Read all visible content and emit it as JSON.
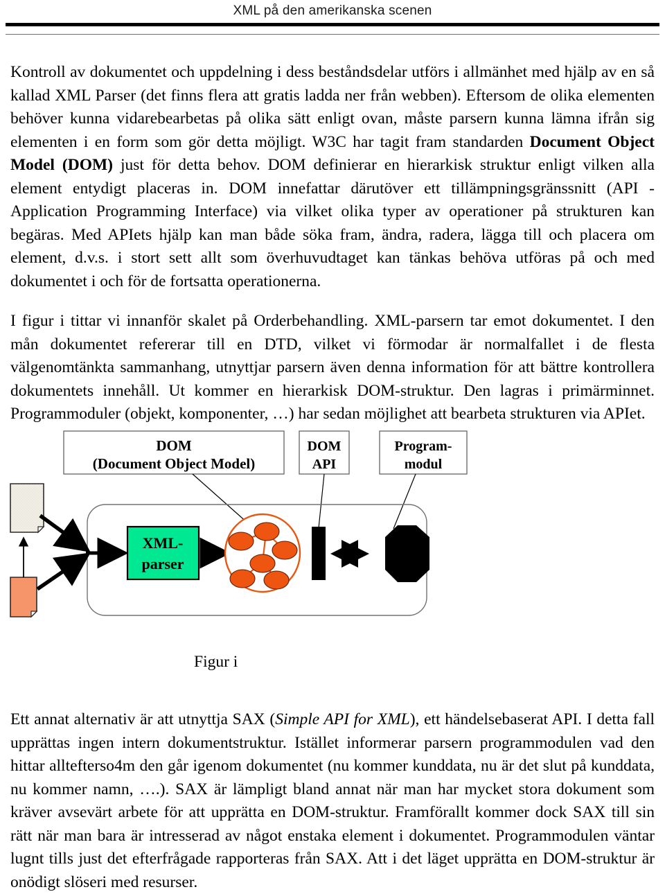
{
  "header": {
    "title": "XML på den amerikanska scenen"
  },
  "body": {
    "paragraph_1_a": "Kontroll av dokumentet och uppdelning i dess beståndsdelar utförs i allmänhet med hjälp av en så kallad XML Parser (det finns flera att gratis ladda ner från webben). Eftersom de olika elementen behöver kunna vidarebearbetas på olika sätt enligt ovan, måste parsern kunna lämna ifrån sig elementen i en form som gör detta möjligt. W3C har tagit fram standarden ",
    "paragraph_1_bold": "Document Object Model (DOM)",
    "paragraph_1_b": " just för detta behov. DOM definierar en hierarkisk struktur enligt vilken alla element entydigt placeras in. DOM innefattar därutöver ett tillämpningsgränssnitt (API - Application Programming Interface) via vilket olika typer av operationer på strukturen kan begäras. Med APIets hjälp kan man både söka fram, ändra, radera, lägga till och placera om element, d.v.s. i stort sett allt som överhuvudtaget kan tänkas behöva utföras på och med dokumentet i och för de fortsatta operationerna.",
    "paragraph_2": "I figur i tittar vi innanför skalet på Orderbehandling. XML-parsern tar emot dokumentet. I den mån dokumentet refererar till en DTD, vilket vi förmodar är normalfallet i de flesta välgenomtänkta sammanhang, utnyttjar parsern även denna information för att bättre kontrollera dokumentets innehåll. Ut kommer en hierarkisk DOM-struktur. Den lagras i primärminnet. Programmoduler (objekt, komponenter, …) har sedan möjlighet att bearbeta strukturen via APIet.",
    "paragraph_3_a": "Ett annat alternativ är att utnyttja SAX (",
    "paragraph_3_italic": "Simple API for XML",
    "paragraph_3_b": "), ett händelsebaserat API. I detta fall upprättas ingen intern dokumentstruktur. Istället informerar parsern programmodulen vad den hittar alltefterso4m den går igenom dokumentet (nu kommer kunddata, nu är det slut på kunddata, nu kommer namn, ….). SAX är lämpligt bland annat när man har mycket stora dokument som kräver avsevärt arbete för att upprätta en DOM-struktur. Framförallt kommer dock SAX till sin rätt när man bara är intresserad av något enstaka element i dokumentet. Programmodulen väntar lugnt tills just det efterfrågade rapporteras från SAX. Att i det läget upprätta en DOM-struktur är onödigt slöseri med resurser."
  },
  "figure": {
    "caption": "Figur i",
    "labels": {
      "dom_line1": "DOM",
      "dom_line2": "(Document Object Model)",
      "domapi_line1": "DOM",
      "domapi_line2": "API",
      "programmodul_line1": "Program-",
      "programmodul_line2": "modul"
    },
    "nodes": {
      "parser": {
        "line1": "XML-",
        "line2": "parser"
      }
    },
    "colors": {
      "parser_fill": "#00e992",
      "tree_accent": "#e8570f",
      "doc_gray": "#efece4",
      "doc_orange": "#f7956a",
      "container_border": "#737373",
      "shape_black": "#000000"
    }
  }
}
